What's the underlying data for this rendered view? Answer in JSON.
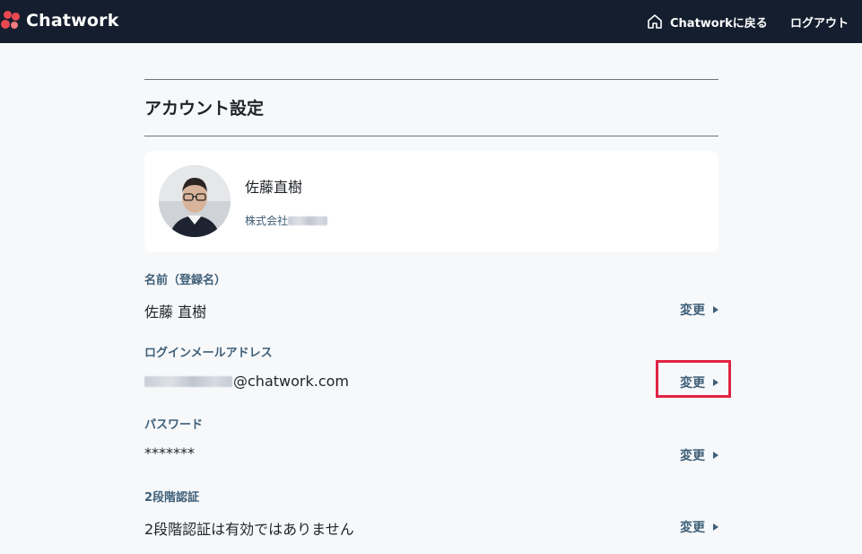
{
  "header": {
    "logo_text": "Chatwork",
    "home_label": "Chatworkに戻る",
    "logout_label": "ログアウト"
  },
  "page": {
    "title": "アカウント設定"
  },
  "profile": {
    "name": "佐藤直樹",
    "company_prefix": "株式会社"
  },
  "fields": [
    {
      "label": "名前（登録名）",
      "value": "佐藤 直樹",
      "action": "変更"
    },
    {
      "label": "ログインメールアドレス",
      "value_suffix": "@chatwork.com",
      "action": "変更"
    },
    {
      "label": "パスワード",
      "value": "*******",
      "action": "変更"
    },
    {
      "label": "2段階認証",
      "value": "2段階認証は有効ではありません",
      "action": "変更"
    }
  ],
  "colors": {
    "header_bg": "#141e2e",
    "label": "#3e5f78",
    "highlight": "#e02443"
  }
}
